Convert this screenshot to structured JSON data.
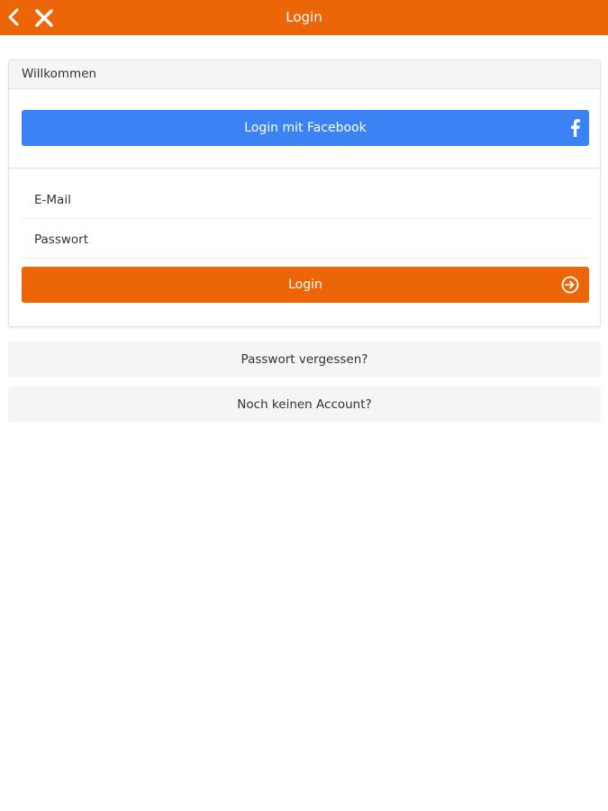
{
  "header": {
    "title": "Login",
    "back_icon": "chevron-left-icon",
    "close_icon": "close-icon",
    "color": "#ec6608"
  },
  "card": {
    "title": "Willkommen",
    "facebook_button": {
      "label": "Login mit Facebook",
      "icon": "facebook-icon",
      "color": "#3b83f5"
    },
    "email_field": {
      "value": "",
      "placeholder": "E-Mail"
    },
    "password_field": {
      "value": "",
      "placeholder": "Passwort"
    },
    "login_button": {
      "label": "Login",
      "icon": "sign-in-icon",
      "color": "#ec6608"
    }
  },
  "links": {
    "forgot_password": "Passwort vergessen?",
    "no_account": "Noch keinen Account?"
  }
}
